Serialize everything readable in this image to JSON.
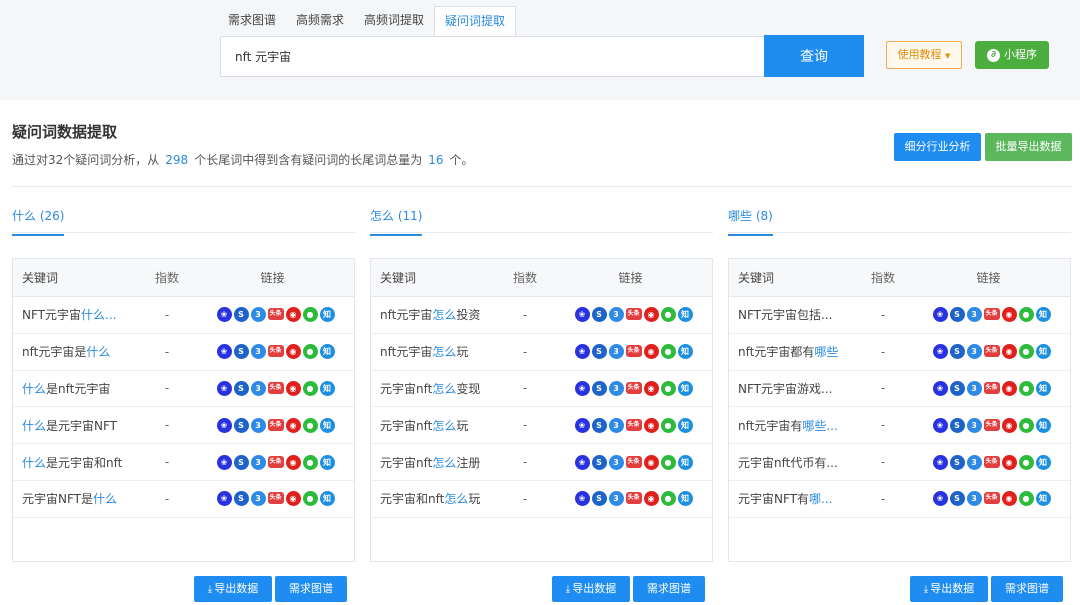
{
  "header": {
    "tabs": [
      {
        "label": "需求图谱"
      },
      {
        "label": "高频需求"
      },
      {
        "label": "高频词提取"
      },
      {
        "label": "疑问词提取"
      }
    ],
    "search_value": "nft 元宇宙",
    "search_button": "查询",
    "tutorial_button": "使用教程",
    "miniapp_button": "小程序"
  },
  "section": {
    "title": "疑问词数据提取",
    "desc_prefix": "通过对32个疑问词分析，从",
    "total": "298",
    "desc_mid": "个长尾词中得到含有疑问词的长尾词总量为",
    "count": "16",
    "desc_suffix": "个。",
    "industry_button": "细分行业分析",
    "batch_button": "批量导出数据"
  },
  "table_headers": {
    "keyword": "关键词",
    "index": "指数",
    "links": "链接"
  },
  "link_icons": [
    "baidu-icon",
    "sogou-icon",
    "360-icon",
    "toutiao-icon",
    "weibo-icon",
    "wechat-icon",
    "zhihu-icon"
  ],
  "columns": [
    {
      "tab": "什么 (26)",
      "rows": [
        {
          "pre": "NFT元宇宙",
          "hl": "什么...",
          "post": "",
          "index": "-"
        },
        {
          "pre": "nft元宇宙是",
          "hl": "什么",
          "post": "",
          "index": "-"
        },
        {
          "pre": "",
          "hl": "什么",
          "post": "是nft元宇宙",
          "index": "-"
        },
        {
          "pre": "",
          "hl": "什么",
          "post": "是元宇宙NFT",
          "index": "-"
        },
        {
          "pre": "",
          "hl": "什么",
          "post": "是元宇宙和nft",
          "index": "-"
        },
        {
          "pre": "元宇宙NFT是",
          "hl": "什么",
          "post": "",
          "index": "-"
        }
      ]
    },
    {
      "tab": "怎么 (11)",
      "rows": [
        {
          "pre": "nft元宇宙",
          "hl": "怎么",
          "post": "投资",
          "index": "-"
        },
        {
          "pre": "nft元宇宙",
          "hl": "怎么",
          "post": "玩",
          "index": "-"
        },
        {
          "pre": "元宇宙nft",
          "hl": "怎么",
          "post": "变现",
          "index": "-"
        },
        {
          "pre": "元宇宙nft",
          "hl": "怎么",
          "post": "玩",
          "index": "-"
        },
        {
          "pre": "元宇宙nft",
          "hl": "怎么",
          "post": "注册",
          "index": "-"
        },
        {
          "pre": "元宇宙和nft",
          "hl": "怎么",
          "post": "玩",
          "index": "-"
        }
      ]
    },
    {
      "tab": "哪些 (8)",
      "rows": [
        {
          "pre": "NFT元宇宙包括...",
          "hl": "",
          "post": "",
          "index": "-"
        },
        {
          "pre": "nft元宇宙都有",
          "hl": "哪些",
          "post": "",
          "index": "-"
        },
        {
          "pre": "NFT元宇宙游戏...",
          "hl": "",
          "post": "",
          "index": "-"
        },
        {
          "pre": "nft元宇宙有",
          "hl": "哪些...",
          "post": "",
          "index": "-"
        },
        {
          "pre": "元宇宙nft代币有...",
          "hl": "",
          "post": "",
          "index": "-"
        },
        {
          "pre": "元宇宙NFT有",
          "hl": "哪...",
          "post": "",
          "index": "-"
        }
      ]
    }
  ],
  "footer_buttons": {
    "export": "导出数据",
    "graph": "需求图谱"
  },
  "colors": {
    "primary": "#1e8cf0",
    "green": "#5cb85c",
    "highlight": "#2b8ae0",
    "orange": "#e08e0b"
  }
}
